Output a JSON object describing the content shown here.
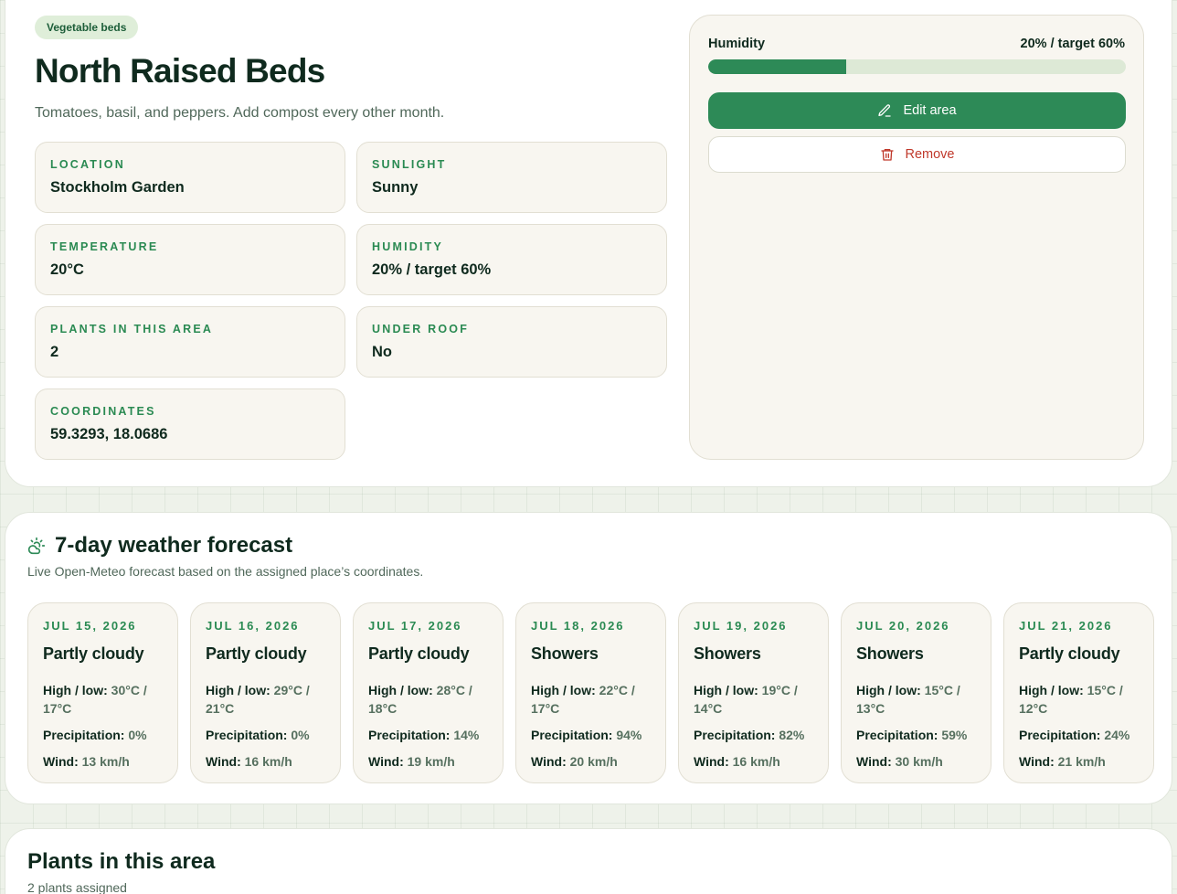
{
  "area": {
    "badge": "Vegetable beds",
    "title": "North Raised Beds",
    "description": "Tomatoes, basil, and peppers. Add compost every other month.",
    "info": [
      {
        "label": "LOCATION",
        "value": "Stockholm Garden"
      },
      {
        "label": "SUNLIGHT",
        "value": "Sunny"
      },
      {
        "label": "TEMPERATURE",
        "value": "20°C"
      },
      {
        "label": "HUMIDITY",
        "value": "20% / target 60%"
      },
      {
        "label": "PLANTS IN THIS AREA",
        "value": "2"
      },
      {
        "label": "UNDER ROOF",
        "value": "No"
      },
      {
        "label": "COORDINATES",
        "value": "59.3293, 18.0686"
      }
    ]
  },
  "side": {
    "humidity_label": "Humidity",
    "humidity_value": "20% / target 60%",
    "humidity_percent": 20,
    "humidity_fill_fraction": 0.33,
    "edit_label": "Edit area",
    "remove_label": "Remove",
    "edit_icon": "pencil-icon",
    "remove_icon": "trash-icon"
  },
  "forecast": {
    "icon": "partly-cloudy-icon",
    "title": "7-day weather forecast",
    "subtitle": "Live Open-Meteo forecast based on the assigned place’s coordinates.",
    "labels": {
      "high_low": "High / low:",
      "precip": "Precipitation:",
      "wind": "Wind:"
    },
    "days": [
      {
        "date": "JUL 15, 2026",
        "condition": "Partly cloudy",
        "high_low": "30°C / 17°C",
        "precip": "0%",
        "wind": "13 km/h"
      },
      {
        "date": "JUL 16, 2026",
        "condition": "Partly cloudy",
        "high_low": "29°C / 21°C",
        "precip": "0%",
        "wind": "16 km/h"
      },
      {
        "date": "JUL 17, 2026",
        "condition": "Partly cloudy",
        "high_low": "28°C / 18°C",
        "precip": "14%",
        "wind": "19 km/h"
      },
      {
        "date": "JUL 18, 2026",
        "condition": "Showers",
        "high_low": "22°C / 17°C",
        "precip": "94%",
        "wind": "20 km/h"
      },
      {
        "date": "JUL 19, 2026",
        "condition": "Showers",
        "high_low": "19°C / 14°C",
        "precip": "82%",
        "wind": "16 km/h"
      },
      {
        "date": "JUL 20, 2026",
        "condition": "Showers",
        "high_low": "15°C / 13°C",
        "precip": "59%",
        "wind": "30 km/h"
      },
      {
        "date": "JUL 21, 2026",
        "condition": "Partly cloudy",
        "high_low": "15°C / 12°C",
        "precip": "24%",
        "wind": "21 km/h"
      }
    ]
  },
  "plants": {
    "title": "Plants in this area",
    "subtitle": "2 plants assigned"
  },
  "colors": {
    "accent": "#2d8a57",
    "label_green": "#2a8a52",
    "danger": "#c0392b",
    "tile_bg": "#f8f6f0"
  }
}
